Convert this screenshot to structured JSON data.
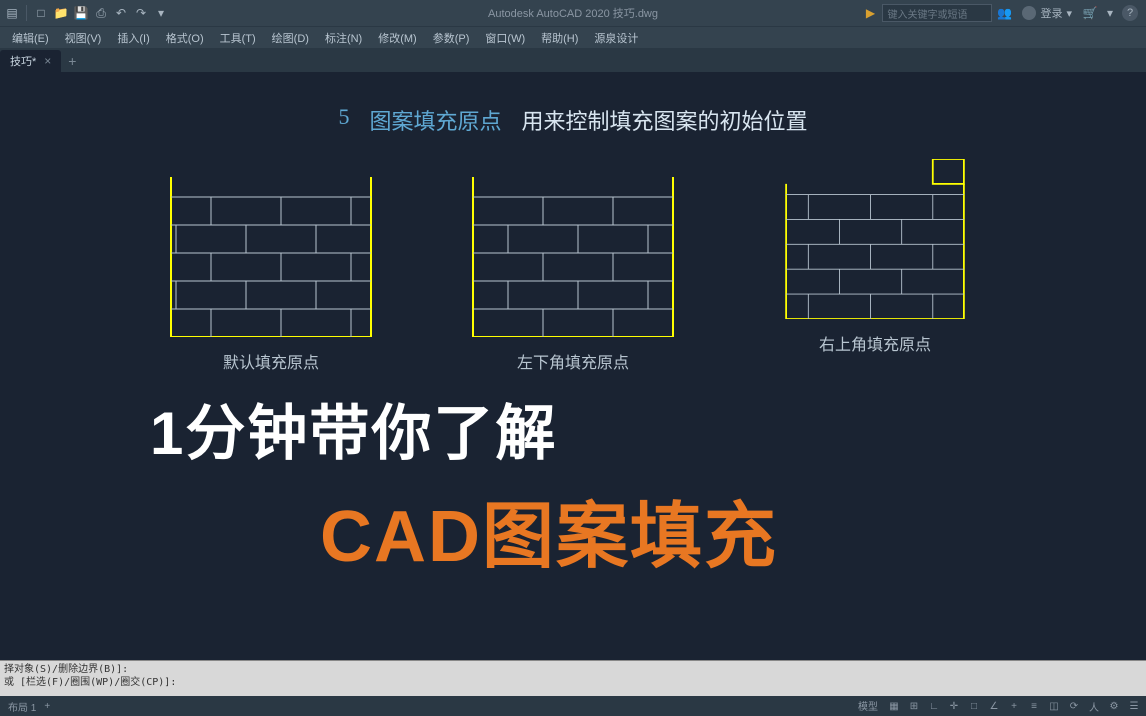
{
  "titlebar": {
    "app_title": "Autodesk AutoCAD 2020  技巧.dwg",
    "search_placeholder": "键入关键字或短语",
    "login_label": "登录"
  },
  "menubar": {
    "items": [
      "编辑(E)",
      "视图(V)",
      "插入(I)",
      "格式(O)",
      "工具(T)",
      "绘图(D)",
      "标注(N)",
      "修改(M)",
      "参数(P)",
      "窗口(W)",
      "帮助(H)",
      "源泉设计"
    ]
  },
  "tabbar": {
    "active_tab": "技巧*"
  },
  "drawing": {
    "title_num": "5",
    "title_blue": "图案填充原点",
    "title_white": "用来控制填充图案的初始位置",
    "patterns": [
      {
        "label": "默认填充原点"
      },
      {
        "label": "左下角填充原点"
      },
      {
        "label": "右上角填充原点"
      }
    ]
  },
  "overlay": {
    "line1": "1分钟带你了解",
    "line2": "CAD图案填充"
  },
  "cmdline": {
    "line1": "择对象(S)/删除边界(B)]:",
    "line2": "或 [栏选(F)/圈围(WP)/圈交(CP)]:"
  },
  "statusbar": {
    "layout": "布局 1",
    "model": "模型"
  }
}
